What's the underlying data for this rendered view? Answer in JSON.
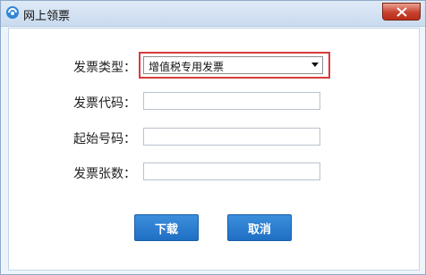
{
  "window": {
    "title": "网上领票",
    "icon": "app-logo-icon",
    "close_icon": "close-icon"
  },
  "form": {
    "type_label": "发票类型：",
    "type_value": "增值税专用发票",
    "code_label": "发票代码：",
    "code_value": "",
    "start_label": "起始号码：",
    "start_value": "",
    "count_label": "发票张数：",
    "count_value": ""
  },
  "buttons": {
    "download": "下载",
    "cancel": "取消"
  },
  "colors": {
    "highlight": "#d93b3b",
    "button": "#2a7bd0"
  }
}
